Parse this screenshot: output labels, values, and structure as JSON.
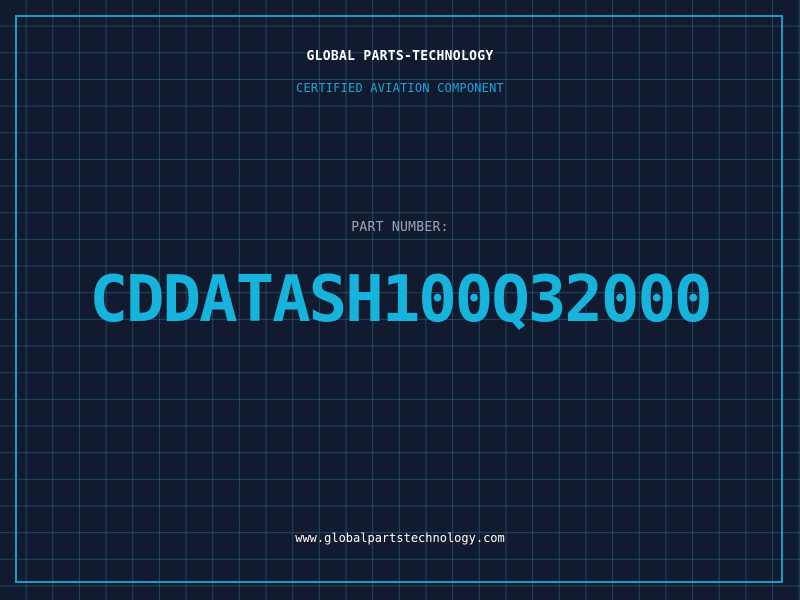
{
  "header": {
    "company": "GLOBAL PARTS-TECHNOLOGY",
    "subtitle": "CERTIFIED AVIATION COMPONENT"
  },
  "part": {
    "label": "PART NUMBER:",
    "number": "CDDATASH100Q32000"
  },
  "footer": {
    "url": "www.globalpartstechnology.com"
  },
  "colors": {
    "background": "#111a2e",
    "grid": "#286e8c",
    "accent": "#16b4dc",
    "frame": "#1a9cc8"
  }
}
